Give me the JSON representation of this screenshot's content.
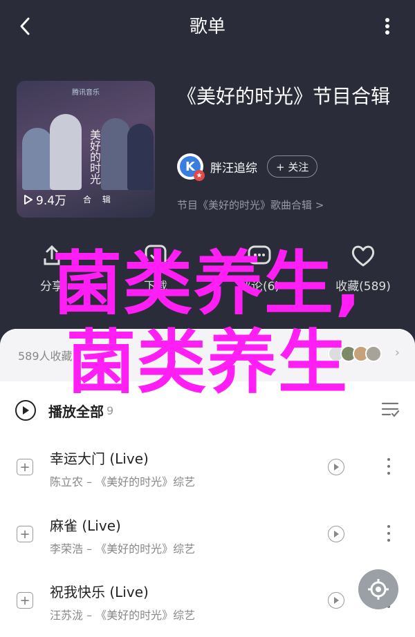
{
  "header": {
    "title": "歌单"
  },
  "cover": {
    "brand": "腾讯音乐",
    "logo_text": "美好的时光",
    "play_count": "9.4万",
    "badge": "合 辑"
  },
  "album": {
    "title": "《美好的时光》节目合辑"
  },
  "creator": {
    "name": "胖汪追综",
    "follow_label": "+ 关注",
    "avatar_letter": "K"
  },
  "subline": "节目《美好的时光》歌曲合辑 >",
  "actions": [
    {
      "label": "分享",
      "icon": "share-icon"
    },
    {
      "label": "下载",
      "icon": "download-icon"
    },
    {
      "label": "评论(6)",
      "icon": "comment-icon"
    },
    {
      "label": "收藏(589)",
      "icon": "heart-icon"
    }
  ],
  "collected": {
    "text": "589人收藏"
  },
  "playall": {
    "label": "播放全部",
    "count": "9"
  },
  "songs": [
    {
      "name": "幸运大门 (Live)",
      "meta": "陈立农 – 《美好的时光》综艺"
    },
    {
      "name": "麻雀 (Live)",
      "meta": "李荣浩 – 《美好的时光》综艺"
    },
    {
      "name": "祝我快乐 (Live)",
      "meta": "汪苏泷 – 《美好的时光》综艺"
    }
  ],
  "watermark": {
    "line1": "菌类养生,",
    "line2": "菌类养生"
  },
  "colors": {
    "background": "#2b2c39",
    "watermark": "#ff1ff5"
  }
}
